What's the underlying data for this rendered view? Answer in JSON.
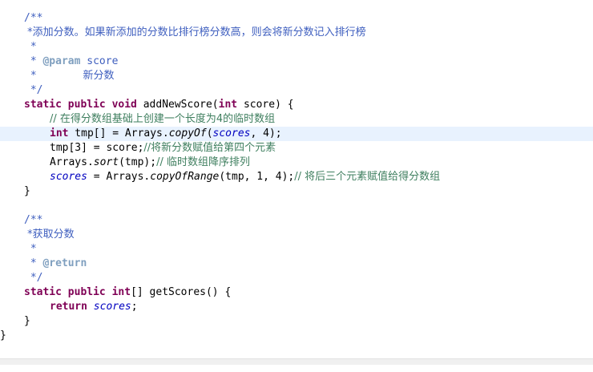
{
  "colors": {
    "keyword": "#7f0055",
    "javadoc": "#3f5fbf",
    "line_comment": "#3f7f5f",
    "javadoc_tag": "#7f9fbf",
    "field": "#0000c0",
    "current_line": "#e8f2fe"
  },
  "editor": {
    "l1": "/**",
    "l2": " *添加分数。如果新添加的分数比排行榜分数高，则会将新分数记入排行榜",
    "l3": " *",
    "l4_star": " * ",
    "l4_tag": "@param",
    "l4_rest": " score",
    "l5_star": " *",
    "l5_text": "              新分数",
    "l6": " */",
    "l7_kw": "static public void",
    "l7_name": " addNewScore(",
    "l7_kw2": "int",
    "l7_rest": " score) {",
    "l8_comment": "// 在得分数组基础上创建一个长度为4的临时数组",
    "l9_kw": "int",
    "l9_a": " tmp[] = Arrays.",
    "l9_m": "copyOf",
    "l9_b": "(",
    "l9_f": "scores",
    "l9_c": ", 4);",
    "l10_code": "tmp[3] = score;",
    "l10_comment": "//将新分数赋值给第四个元素",
    "l11_a": "Arrays.",
    "l11_m": "sort",
    "l11_b": "(tmp);",
    "l11_comment": "// 临时数组降序排列",
    "l12_f": "scores",
    "l12_a": " = Arrays.",
    "l12_m": "copyOfRange",
    "l12_b": "(tmp, 1, 4);",
    "l12_comment": "// 将后三个元素赋值给得分数组",
    "l13": "}",
    "l15": "/**",
    "l16": " *获取分数",
    "l17": " *",
    "l18_star": " * ",
    "l18_tag": "@return",
    "l19": " */",
    "l20_kw": "static public",
    "l20_a": " ",
    "l20_kw2": "int",
    "l20_b": "[] getScores() {",
    "l21_kw": "return",
    "l21_a": " ",
    "l21_f": "scores",
    "l21_b": ";",
    "l22": "}",
    "l23": "}"
  }
}
